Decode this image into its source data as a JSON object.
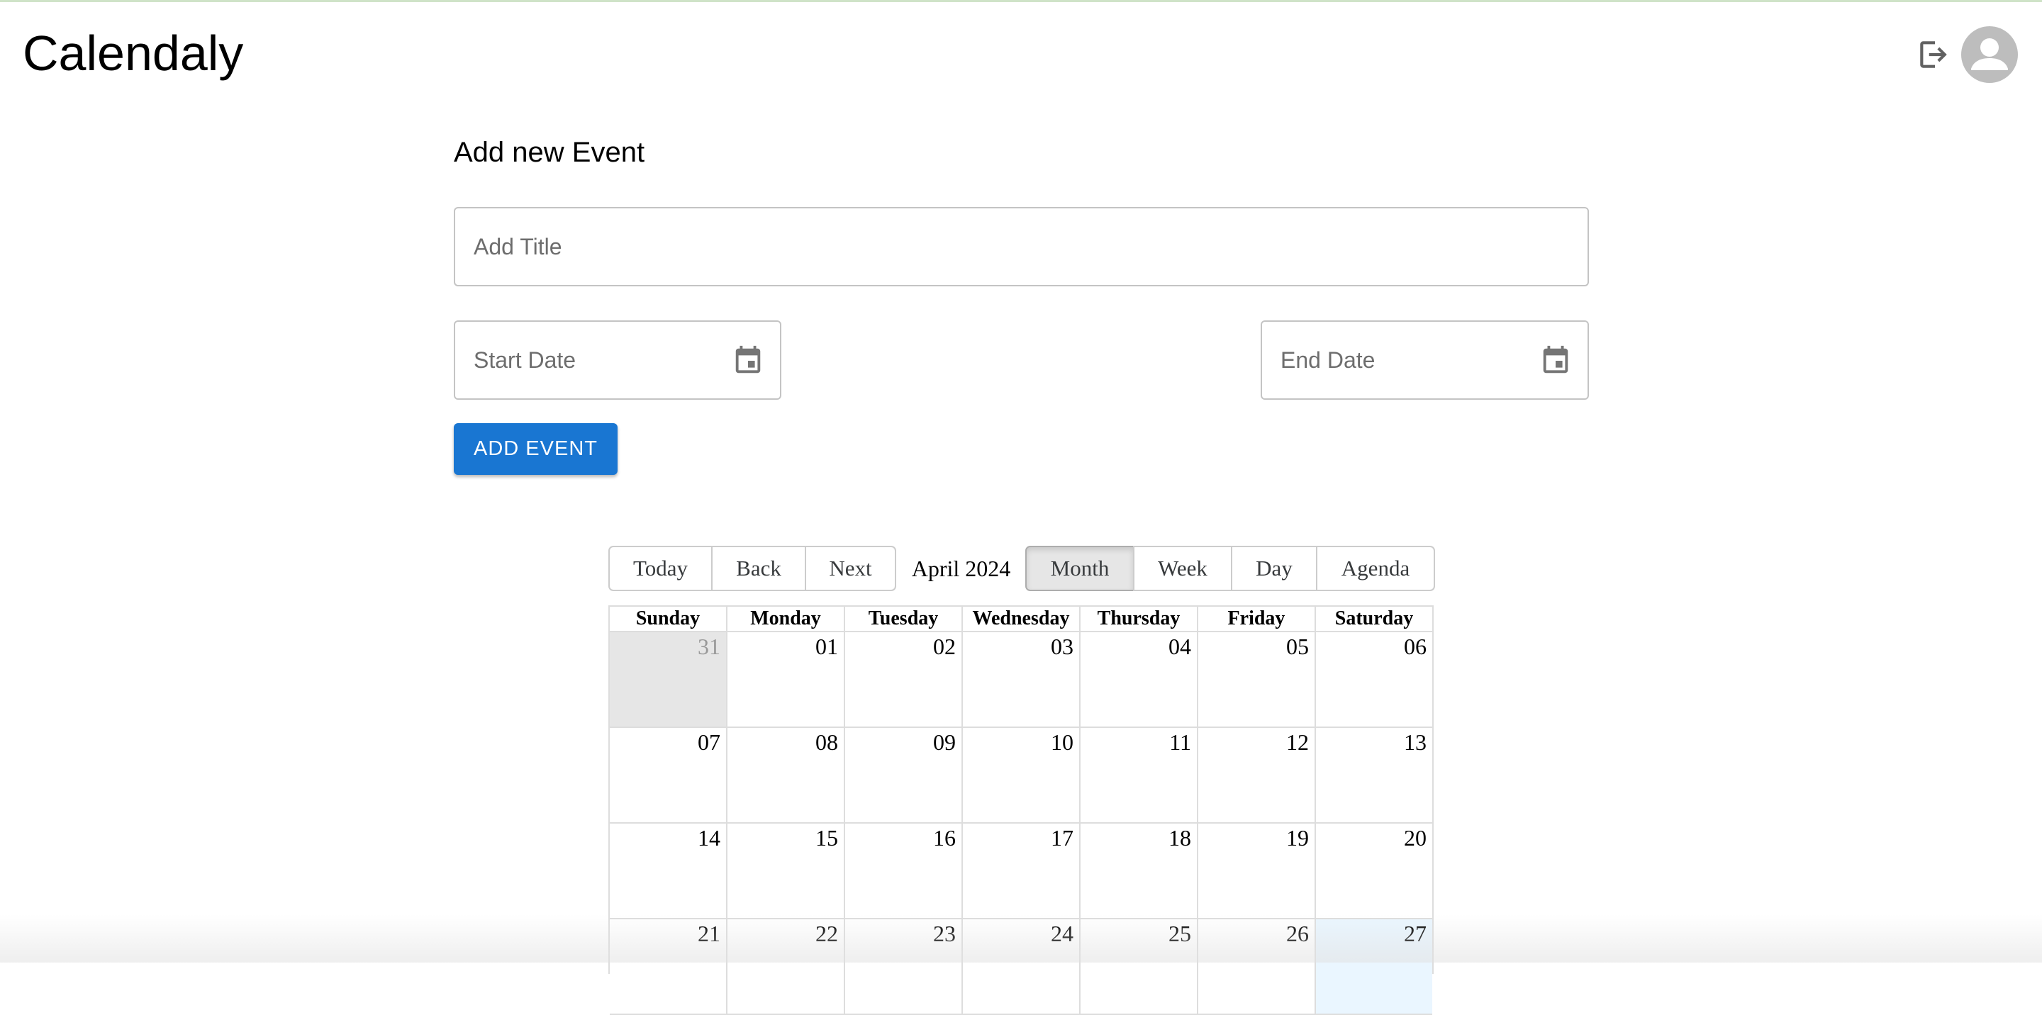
{
  "app": {
    "title": "Calendaly"
  },
  "header": {
    "logout_icon": "logout-icon",
    "avatar_icon": "account-circle-icon"
  },
  "form": {
    "heading": "Add new Event",
    "title_placeholder": "Add Title",
    "start_placeholder": "Start Date",
    "end_placeholder": "End Date",
    "add_button": "ADD EVENT",
    "date_icon": "calendar-icon"
  },
  "calendar": {
    "nav_buttons": [
      "Today",
      "Back",
      "Next"
    ],
    "label": "April 2024",
    "views": [
      "Month",
      "Week",
      "Day",
      "Agenda"
    ],
    "active_view": "Month",
    "weekdays": [
      "Sunday",
      "Monday",
      "Tuesday",
      "Wednesday",
      "Thursday",
      "Friday",
      "Saturday"
    ],
    "weeks": [
      [
        "31",
        "01",
        "02",
        "03",
        "04",
        "05",
        "06"
      ],
      [
        "07",
        "08",
        "09",
        "10",
        "11",
        "12",
        "13"
      ],
      [
        "14",
        "15",
        "16",
        "17",
        "18",
        "19",
        "20"
      ],
      [
        "21",
        "22",
        "23",
        "24",
        "25",
        "26",
        "27"
      ]
    ],
    "off_range_day": "31",
    "today": "27"
  },
  "colors": {
    "primary": "#1976d2",
    "today_bg": "#eaf6ff",
    "off_range_bg": "#e6e6e6"
  }
}
